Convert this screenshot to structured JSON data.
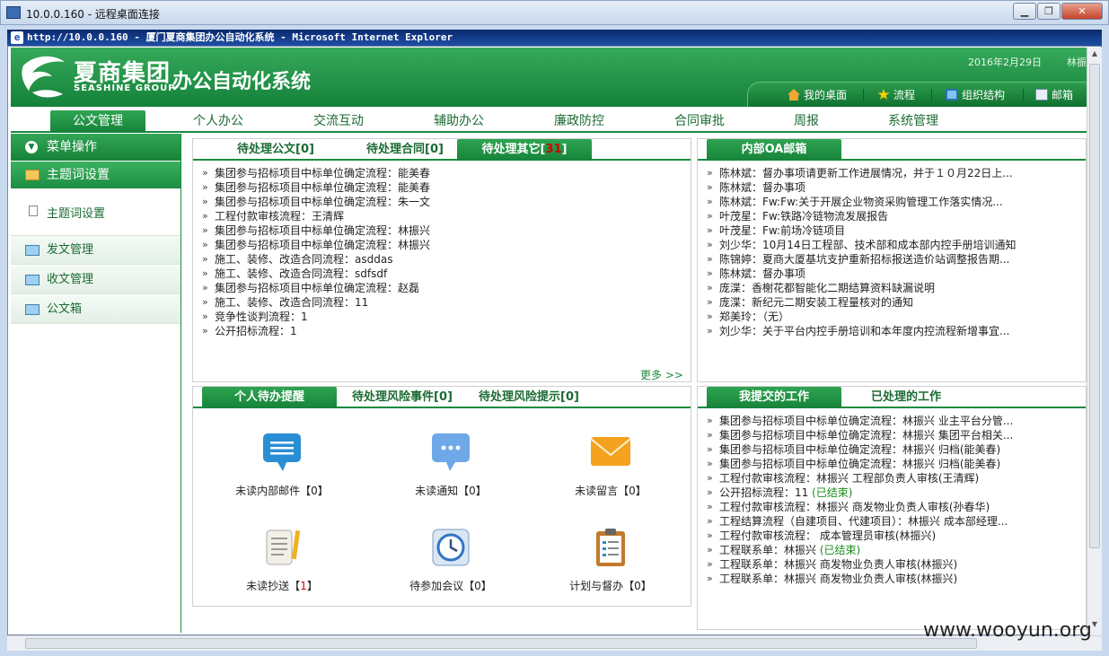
{
  "rdp": {
    "title": "10.0.0.160 - 远程桌面连接"
  },
  "ie": {
    "title": "http://10.0.0.160 - 厦门夏商集团办公自动化系统 - Microsoft Internet Explorer"
  },
  "header": {
    "logo_cn": "夏商集团",
    "logo_en": "SEASHINE GROUP",
    "app_name": "办公自动化系统",
    "date": "2016年2月29日",
    "user": "林振",
    "links": [
      "我的桌面",
      "流程",
      "组织结构",
      "邮箱"
    ]
  },
  "nav": [
    "公文管理",
    "个人办公",
    "交流互动",
    "辅助办公",
    "廉政防控",
    "合同审批",
    "周报",
    "系统管理"
  ],
  "sidebar": {
    "menu_header": "菜单操作",
    "section": "主题词设置",
    "sub_item": "主题词设置",
    "items": [
      "发文管理",
      "收文管理",
      "公文箱"
    ]
  },
  "pending": {
    "tabs": [
      "待处理公文[0]",
      "待处理合同[0]",
      "待处理其它["
    ],
    "tab3_count": "31",
    "tab3_suffix": "]",
    "items": [
      "集团参与招标项目中标单位确定流程：能美春",
      "集团参与招标项目中标单位确定流程：能美春",
      "集团参与招标项目中标单位确定流程：朱一文",
      "工程付款审核流程：王清辉",
      "集团参与招标项目中标单位确定流程：林振兴",
      "集团参与招标项目中标单位确定流程：林振兴",
      "施工、装修、改造合同流程：asddas",
      "施工、装修、改造合同流程：sdfsdf",
      "集团参与招标项目中标单位确定流程：赵磊",
      "施工、装修、改造合同流程：11",
      "竞争性谈判流程：1",
      "公开招标流程：1"
    ],
    "more": "更多 >>"
  },
  "mail": {
    "tab": "内部OA邮箱",
    "items": [
      "陈林斌：督办事项请更新工作进展情况，并于１０月22日上...",
      "陈林斌：督办事项",
      "陈林斌：Fw:Fw:关于开展企业物资采购管理工作落实情况...",
      "叶茂星：Fw:铁路冷链物流发展报告",
      "叶茂星：Fw:前场冷链项目",
      "刘少华：10月14日工程部、技术部和成本部内控手册培训通知",
      "陈锦婷：夏商大厦基坑支护重新招标报送造价站调整报告期...",
      "陈林斌：督办事项",
      "庞渫：香榭花都智能化二期结算资料缺漏说明",
      "庞渫：新纪元二期安装工程量核对的通知",
      "郑美玲：（无）",
      "刘少华：关于平台内控手册培训和本年度内控流程新增事宜..."
    ]
  },
  "reminders": {
    "tabs": [
      "个人待办提醒",
      "待处理风险事件[0]",
      "待处理风险提示[0]"
    ],
    "icons": [
      {
        "label": "未读内部邮件【0】",
        "icon": "message-bubble-icon"
      },
      {
        "label": "未读通知【0】",
        "icon": "notice-bubble-icon"
      },
      {
        "label": "未读留言【0】",
        "icon": "envelope-icon"
      },
      {
        "label_pre": "未读抄送【",
        "label_num": "1",
        "label_post": "】",
        "icon": "scroll-pencil-icon"
      },
      {
        "label": "待参加会议【0】",
        "icon": "clock-icon"
      },
      {
        "label": "计划与督办【0】",
        "icon": "clipboard-icon"
      }
    ]
  },
  "submitted": {
    "tabs": [
      "我提交的工作",
      "已处理的工作"
    ],
    "items": [
      {
        "text": "集团参与招标项目中标单位确定流程：林振兴 业主平台分管..."
      },
      {
        "text": "集团参与招标项目中标单位确定流程：林振兴 集团平台相关..."
      },
      {
        "text": "集团参与招标项目中标单位确定流程：林振兴 归档(能美春)"
      },
      {
        "text": "集团参与招标项目中标单位确定流程：林振兴 归档(能美春)"
      },
      {
        "text": "工程付款审核流程：林振兴 工程部负责人审核(王清辉)"
      },
      {
        "text": "公开招标流程：11 ",
        "status": "(已结束)"
      },
      {
        "text": "工程付款审核流程：林振兴 商发物业负责人审核(孙春华)"
      },
      {
        "text": "工程结算流程（自建项目、代建项目）：林振兴 成本部经理..."
      },
      {
        "text": "工程付款审核流程： 成本管理员审核(林振兴)"
      },
      {
        "text": "工程联系单：林振兴 ",
        "status": "(已结束)"
      },
      {
        "text": "工程联系单：林振兴 商发物业负责人审核(林振兴)"
      },
      {
        "text": "工程联系单：林振兴 商发物业负责人审核(林振兴)"
      }
    ]
  },
  "watermark": "www.wooyun.org"
}
